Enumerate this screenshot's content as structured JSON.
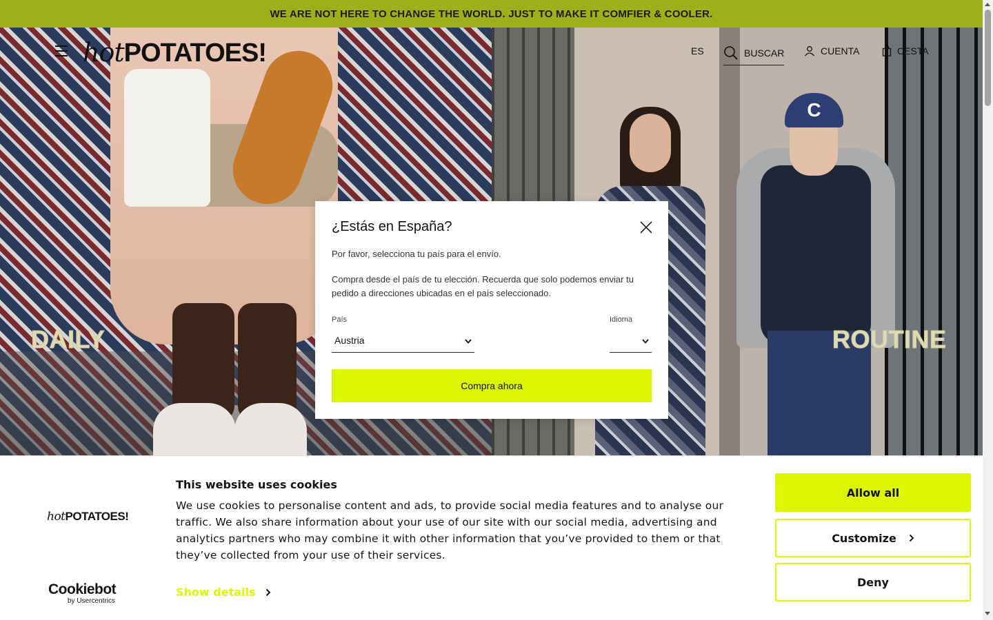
{
  "announcement": {
    "text": "WE ARE NOT HERE TO CHANGE THE WORLD. JUST TO MAKE IT COMFIER & COOLER."
  },
  "header": {
    "logo": {
      "script_part": "hot",
      "bold_part": "POTATOES!"
    },
    "nav": {
      "language": "ES",
      "search": "BUSCAR",
      "account": "CUENTA",
      "cart": "CESTA"
    },
    "icons": [
      "menu-icon",
      "search-icon",
      "user-icon",
      "bag-icon"
    ]
  },
  "hero": {
    "left_word": "DAILY",
    "right_word": "ROUTINE",
    "cap_letter": "C"
  },
  "modal": {
    "title": "¿Estás en España?",
    "paragraph1": "Por favor, selecciona tu país para el envío.",
    "paragraph2": "Compra desde el país de tu elección. Recuerda que solo podemos enviar tu pedido a direcciones ubicadas en el país seleccionado.",
    "country_label": "País",
    "country_value": "Austria",
    "language_label": "Idioma",
    "language_value": "",
    "button": "Compra ahora"
  },
  "cookie_banner": {
    "logo": {
      "script_part": "hot",
      "bold_part": "POTATOES!"
    },
    "provider": {
      "name": "Cookiebot",
      "byline": "by Usercentrics"
    },
    "title": "This website uses cookies",
    "text": "We use cookies to personalise content and ads, to provide social media features and to analyse our traffic. We also share information about your use of our site with our social media, advertising and analytics partners who may combine it with other information that you’ve provided to them or that they’ve collected from your use of their services.",
    "show_details": "Show details",
    "allow_all": "Allow all",
    "customize": "Customize",
    "deny": "Deny"
  },
  "colors": {
    "announcement_bg": "#9db01a",
    "accent": "#dcf500",
    "text": "#141414"
  }
}
